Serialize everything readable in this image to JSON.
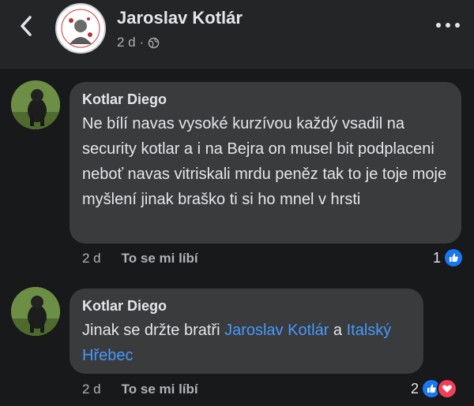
{
  "header": {
    "title": "Jaroslav Kotlár",
    "time": "2 d",
    "separator": "·",
    "privacy_icon": "globe-icon",
    "back_icon": "chevron-left-icon",
    "more_icon": "more-horizontal-icon"
  },
  "comments": [
    {
      "author": "Kotlar Diego",
      "text": "Ne bílí navas vysoké  kurzívou každý vsadil na security kotlar a i na Bejra on musel bit podplaceni neboť navas vitriskali mrdu peněz tak to je toje moje myšlení jinak braško ti si ho mnel v hrsti",
      "time": "2 d",
      "like_label": "To se mi líbí",
      "reaction_count": "1",
      "reactions": [
        "like"
      ]
    },
    {
      "author": "Kotlar Diego",
      "text_prefix": "Jinak se držte bratři ",
      "mention_1": "Jaroslav Kotlár",
      "text_mid": " a ",
      "mention_2": "Italský Hřebec",
      "time": "2 d",
      "like_label": "To se mi líbí",
      "reaction_count": "2",
      "reactions": [
        "like",
        "love"
      ]
    }
  ],
  "colors": {
    "background": "#18191a",
    "bubble": "#3a3b3c",
    "mention": "#4599ff",
    "like": "#1877f2",
    "love": "#f33e58"
  }
}
